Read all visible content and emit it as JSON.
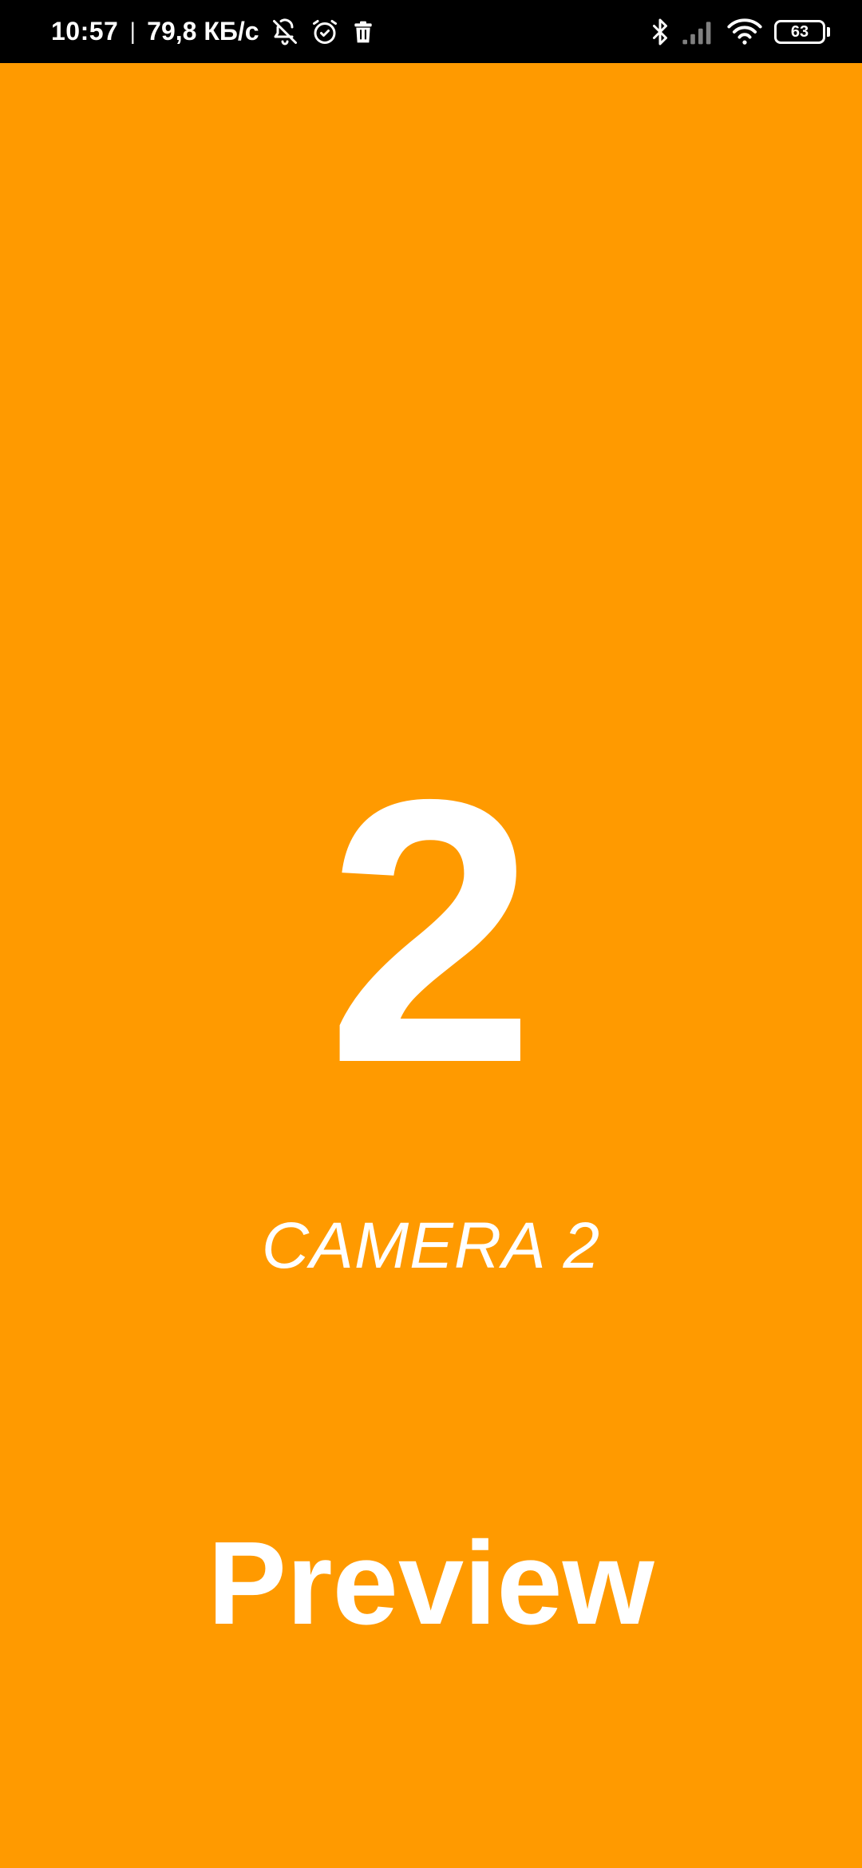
{
  "status_bar": {
    "time": "10:57",
    "separator": "|",
    "net_speed": "79,8 КБ/с",
    "battery_level": "63",
    "icons": [
      "bell-off-icon",
      "alarm-clock-icon",
      "trash-icon",
      "bluetooth-icon",
      "signal-icon",
      "wifi-icon",
      "battery-icon"
    ]
  },
  "main": {
    "big_number": "2",
    "camera_label": "CAMERA 2",
    "preview_label": "Preview"
  },
  "colors": {
    "background": "#FF9A00",
    "status_bar": "#000000",
    "text": "#FFFFFF"
  }
}
